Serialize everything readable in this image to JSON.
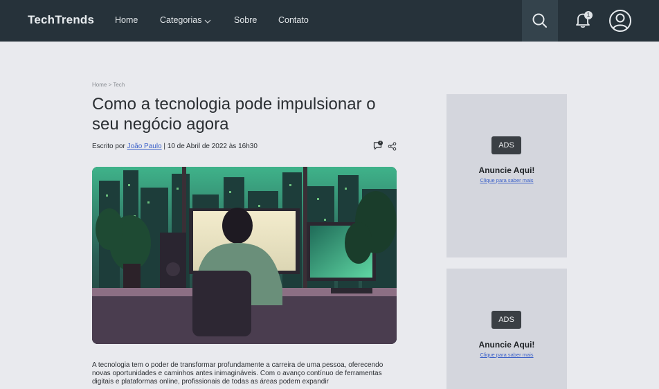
{
  "header": {
    "brand": "TechTrends",
    "nav": {
      "home": "Home",
      "categories": "Categorias",
      "about": "Sobre",
      "contact": "Contato"
    },
    "notifications_count": "1"
  },
  "article": {
    "breadcrumb": "Home > Tech",
    "title": "Como a tecnologia pode impulsionar o seu negócio agora",
    "byline_prefix": "Escrito por ",
    "author": "João Paulo",
    "byline_suffix": " | 10 de Abril de 2022 às 16h30",
    "comments_count": "2",
    "body": "A tecnologia tem o poder de transformar profundamente a carreira de uma pessoa, oferecendo novas oportunidades e caminhos antes inimagináveis. Com o avanço contínuo de ferramentas digitais e plataformas online, profissionais de todas as áreas podem expandir"
  },
  "ads": [
    {
      "tag": "ADS",
      "title": "Anuncie Aqui!",
      "link": "Clique para saber mais"
    },
    {
      "tag": "ADS",
      "title": "Anuncie Aqui!",
      "link": "Clique para saber mais"
    }
  ],
  "colors": {
    "header_bg": "#26323a",
    "page_bg": "#e9eaee",
    "ad_bg": "#d4d6dd",
    "link": "#3d62c9"
  }
}
